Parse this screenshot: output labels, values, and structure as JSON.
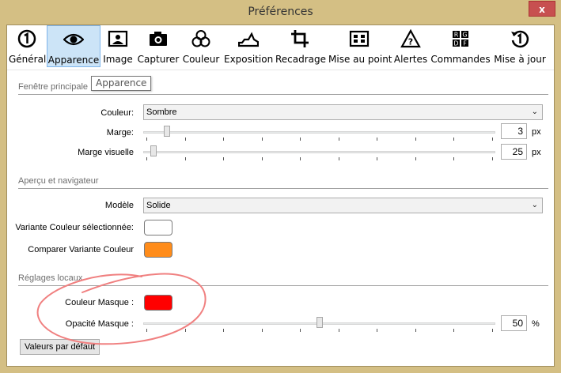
{
  "window": {
    "title": "Préférences",
    "close_label": "x"
  },
  "toolbar": {
    "tabs": [
      {
        "label": "Général",
        "icon": "number-one-circle-icon"
      },
      {
        "label": "Apparence",
        "icon": "eye-icon"
      },
      {
        "label": "Image",
        "icon": "picture-frame-icon"
      },
      {
        "label": "Capturer",
        "icon": "camera-icon"
      },
      {
        "label": "Couleur",
        "icon": "color-circles-icon"
      },
      {
        "label": "Exposition",
        "icon": "exposure-histogram-icon"
      },
      {
        "label": "Recadrage",
        "icon": "crop-icon"
      },
      {
        "label": "Mise au point",
        "icon": "focus-grid-icon"
      },
      {
        "label": "Alertes",
        "icon": "warning-triangle-icon"
      },
      {
        "label": "Commandes",
        "icon": "keyboard-keys-icon"
      },
      {
        "label": "Mise à jour",
        "icon": "update-cycle-icon"
      }
    ],
    "active": "Apparence",
    "tooltip": "Apparence"
  },
  "sections": {
    "main_window": {
      "title": "Fenêtre principale",
      "color_label": "Couleur:",
      "color_value": "Sombre",
      "margin_label": "Marge:",
      "margin_value": "3",
      "margin_unit": "px",
      "margin_slider_fraction": 0.06,
      "visual_margin_label": "Marge visuelle",
      "visual_margin_value": "25",
      "visual_margin_unit": "px",
      "visual_margin_slider_fraction": 0.02
    },
    "preview": {
      "title": "Aperçu et navigateur",
      "model_label": "Modèle",
      "model_value": "Solide",
      "selected_variant_label": "Variante Couleur sélectionnée:",
      "selected_variant_color": "#ffffff",
      "compare_variant_label": "Comparer Variante Couleur",
      "compare_variant_color": "#ff8c1a"
    },
    "local": {
      "title": "Réglages locaux",
      "mask_color_label": "Couleur Masque :",
      "mask_color": "#ff0000",
      "mask_opacity_label": "Opacité Masque :",
      "mask_opacity_value": "50",
      "mask_opacity_unit": "%",
      "mask_opacity_slider_fraction": 0.5
    }
  },
  "defaults_button": "Valeurs par défaut",
  "colors": {
    "accent": "#cce4f7",
    "frame": "#d4bf84",
    "annotation": "#f08080"
  }
}
